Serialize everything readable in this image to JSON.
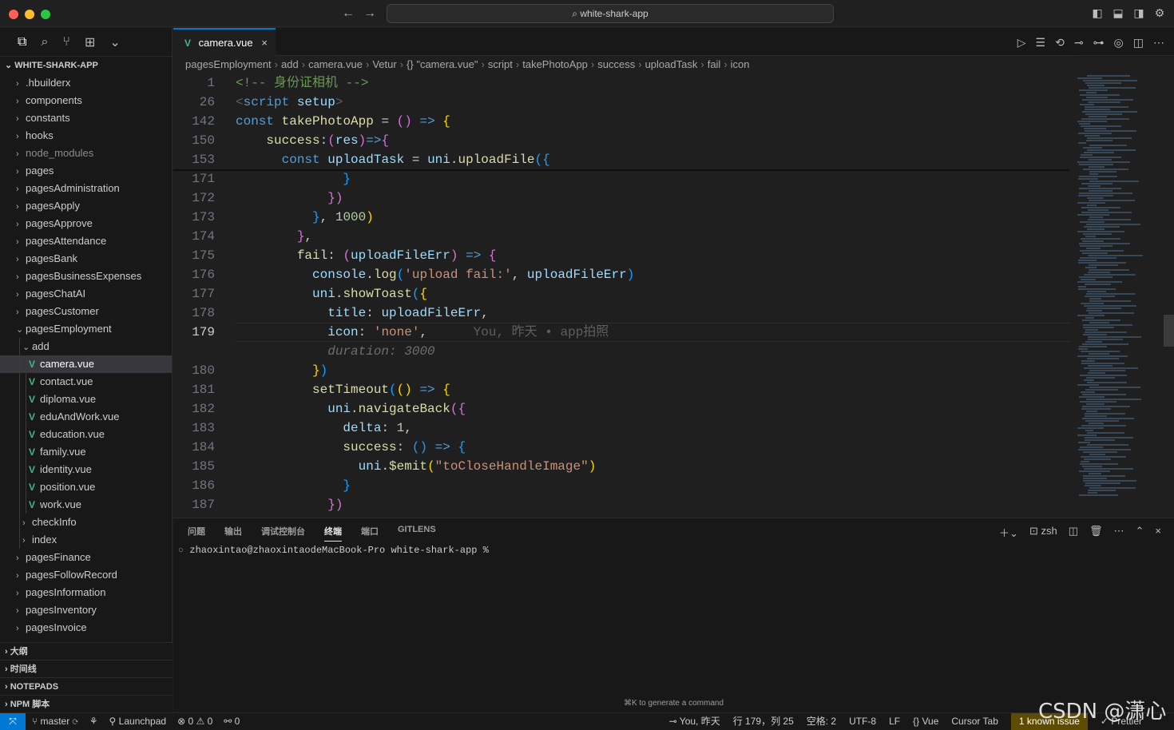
{
  "window": {
    "title": "white-shark-app"
  },
  "sidebar": {
    "root": "WHITE-SHARK-APP",
    "items": [
      {
        "label": ".hbuilderx",
        "type": "folder",
        "depth": 0
      },
      {
        "label": "components",
        "type": "folder",
        "depth": 0
      },
      {
        "label": "constants",
        "type": "folder",
        "depth": 0
      },
      {
        "label": "hooks",
        "type": "folder",
        "depth": 0
      },
      {
        "label": "node_modules",
        "type": "folder",
        "depth": 0,
        "dim": true
      },
      {
        "label": "pages",
        "type": "folder",
        "depth": 0
      },
      {
        "label": "pagesAdministration",
        "type": "folder",
        "depth": 0
      },
      {
        "label": "pagesApply",
        "type": "folder",
        "depth": 0
      },
      {
        "label": "pagesApprove",
        "type": "folder",
        "depth": 0
      },
      {
        "label": "pagesAttendance",
        "type": "folder",
        "depth": 0
      },
      {
        "label": "pagesBank",
        "type": "folder",
        "depth": 0
      },
      {
        "label": "pagesBusinessExpenses",
        "type": "folder",
        "depth": 0
      },
      {
        "label": "pagesChatAI",
        "type": "folder",
        "depth": 0
      },
      {
        "label": "pagesCustomer",
        "type": "folder",
        "depth": 0
      },
      {
        "label": "pagesEmployment",
        "type": "folder-open",
        "depth": 0
      },
      {
        "label": "add",
        "type": "folder-open",
        "depth": 1
      },
      {
        "label": "camera.vue",
        "type": "vue",
        "depth": 2,
        "selected": true
      },
      {
        "label": "contact.vue",
        "type": "vue",
        "depth": 2
      },
      {
        "label": "diploma.vue",
        "type": "vue",
        "depth": 2
      },
      {
        "label": "eduAndWork.vue",
        "type": "vue",
        "depth": 2
      },
      {
        "label": "education.vue",
        "type": "vue",
        "depth": 2
      },
      {
        "label": "family.vue",
        "type": "vue",
        "depth": 2
      },
      {
        "label": "identity.vue",
        "type": "vue",
        "depth": 2
      },
      {
        "label": "position.vue",
        "type": "vue",
        "depth": 2
      },
      {
        "label": "work.vue",
        "type": "vue",
        "depth": 2
      },
      {
        "label": "checkInfo",
        "type": "folder",
        "depth": 1
      },
      {
        "label": "index",
        "type": "folder",
        "depth": 1
      },
      {
        "label": "pagesFinance",
        "type": "folder",
        "depth": 0
      },
      {
        "label": "pagesFollowRecord",
        "type": "folder",
        "depth": 0
      },
      {
        "label": "pagesInformation",
        "type": "folder",
        "depth": 0
      },
      {
        "label": "pagesInventory",
        "type": "folder",
        "depth": 0
      },
      {
        "label": "pagesInvoice",
        "type": "folder",
        "depth": 0
      }
    ],
    "sections": [
      "大纲",
      "时间线",
      "NOTEPADS",
      "NPM 脚本"
    ]
  },
  "editor": {
    "tab": "camera.vue",
    "breadcrumb": [
      "pagesEmployment",
      "add",
      "camera.vue",
      "Vetur",
      "{} \"camera.vue\"",
      "script",
      "takePhotoApp",
      "success",
      "uploadTask",
      "fail",
      "icon"
    ],
    "lines": [
      {
        "n": "1",
        "html": "<span class='c'>&lt;!-- 身份证相机 --&gt;</span>"
      },
      {
        "n": "26",
        "html": "<span class='g2'>&lt;</span><span class='k'>script</span> <span class='v'>setup</span><span class='g2'>&gt;</span>"
      },
      {
        "n": "142",
        "html": "<span class='k'>const</span> <span class='f'>takePhotoApp</span> <span class='p'>=</span> <span class='m'>()</span> <span class='k'>=&gt;</span> <span class='y'>{</span>"
      },
      {
        "n": "150",
        "html": "    <span class='f'>success</span><span class='p'>:</span><span class='m'>(</span><span class='v'>res</span><span class='m'>)</span><span class='k'>=&gt;</span><span class='m'>{</span>"
      },
      {
        "n": "153",
        "html": "      <span class='k'>const</span> <span class='v'>uploadTask</span> <span class='p'>=</span> <span class='v'>uni</span><span class='p'>.</span><span class='f'>uploadFile</span><span class='b'>({</span>"
      },
      {
        "n": "171",
        "html": "              <span class='b'>}</span>"
      },
      {
        "n": "172",
        "html": "            <span class='m'>})</span>"
      },
      {
        "n": "173",
        "html": "          <span class='b'>}</span><span class='p'>,</span> <span class='n'>1000</span><span class='y'>)</span>"
      },
      {
        "n": "174",
        "html": "        <span class='m'>}</span><span class='p'>,</span>"
      },
      {
        "n": "175",
        "html": "        <span class='f'>fail</span><span class='p'>:</span> <span class='m'>(</span><span class='v'>uploadFileErr</span><span class='m'>)</span> <span class='k'>=&gt;</span> <span class='m'>{</span>"
      },
      {
        "n": "176",
        "html": "          <span class='v'>console</span><span class='p'>.</span><span class='f'>log</span><span class='b'>(</span><span class='s'>'upload fail:'</span><span class='p'>,</span> <span class='v'>uploadFileErr</span><span class='b'>)</span>"
      },
      {
        "n": "177",
        "html": "          <span class='v'>uni</span><span class='p'>.</span><span class='f'>showToast</span><span class='b'>(</span><span class='y'>{</span>"
      },
      {
        "n": "178",
        "html": "            <span class='v'>title</span><span class='p'>:</span> <span class='v'>uploadFileErr</span><span class='p'>,</span>"
      },
      {
        "n": "179",
        "html": "            <span class='v'>icon</span><span class='p'>:</span> <span class='s'>'none'</span><span class='p'>,</span>      <span class='g2'>You, 昨天 • app拍照</span>",
        "active": true
      },
      {
        "n": "",
        "html": "            <span class='g'>duration: 3000</span>"
      },
      {
        "n": "180",
        "html": "          <span class='y'>}</span><span class='b'>)</span>"
      },
      {
        "n": "181",
        "html": "          <span class='f'>setTimeout</span><span class='b'>(</span><span class='y'>()</span> <span class='k'>=&gt;</span> <span class='y'>{</span>"
      },
      {
        "n": "182",
        "html": "            <span class='v'>uni</span><span class='p'>.</span><span class='f'>navigateBack</span><span class='m'>({</span>"
      },
      {
        "n": "183",
        "html": "              <span class='v'>delta</span><span class='p'>:</span> <span class='n'>1</span><span class='p'>,</span>"
      },
      {
        "n": "184",
        "html": "              <span class='f'>success</span><span class='p'>:</span> <span class='b'>()</span> <span class='k'>=&gt;</span> <span class='b'>{</span>"
      },
      {
        "n": "185",
        "html": "                <span class='v'>uni</span><span class='p'>.</span><span class='f'>$emit</span><span class='y'>(</span><span class='s'>\"toCloseHandleImage\"</span><span class='y'>)</span>"
      },
      {
        "n": "186",
        "html": "              <span class='b'>}</span>"
      },
      {
        "n": "187",
        "html": "            <span class='m'>})</span>"
      }
    ]
  },
  "panel": {
    "tabs": [
      "问题",
      "输出",
      "调试控制台",
      "终端",
      "端口",
      "GITLENS"
    ],
    "active_tab": "终端",
    "shell": "zsh",
    "prompt": "zhaoxintao@zhaoxintaodeMacBook-Pro white-shark-app %",
    "hint": "⌘K to generate a command"
  },
  "status": {
    "branch": "master",
    "launchpad": "Launchpad",
    "errors": "0",
    "warnings": "0",
    "ports": "0",
    "blame": "You, 昨天",
    "position": "行 179，列 25",
    "spaces": "空格: 2",
    "encoding": "UTF-8",
    "eol": "LF",
    "language": "Vue",
    "cursor_tab": "Cursor Tab",
    "known_issue": "1 known issue",
    "prettier": "Prettier"
  },
  "watermark": "CSDN @潇心"
}
